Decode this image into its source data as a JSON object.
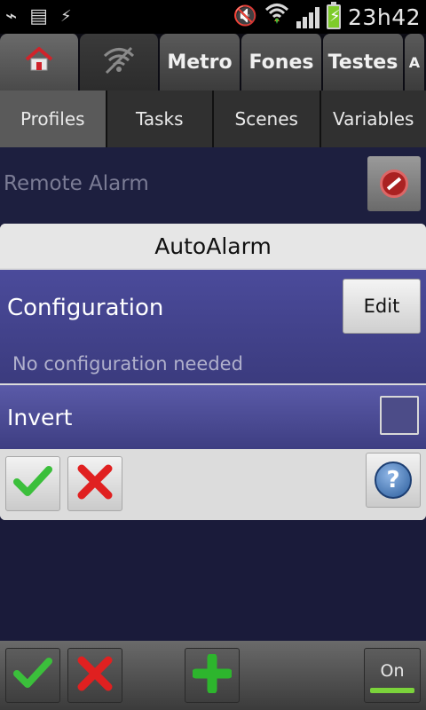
{
  "status_bar": {
    "time": "23h42",
    "icons": [
      "usb-icon",
      "sim-card-icon",
      "bolt-icon",
      "mute-icon",
      "wifi-icon",
      "signal-icon",
      "battery-icon"
    ]
  },
  "top_tabs": [
    {
      "label": "",
      "icon": "home-icon"
    },
    {
      "label": "",
      "icon": "wifi-icon"
    },
    {
      "label": "Metro"
    },
    {
      "label": "Fones"
    },
    {
      "label": "Testes"
    },
    {
      "label": "A"
    }
  ],
  "sub_tabs": [
    {
      "label": "Profiles",
      "active": true
    },
    {
      "label": "Tasks"
    },
    {
      "label": "Scenes"
    },
    {
      "label": "Variables"
    }
  ],
  "background_item": {
    "label": "Remote Alarm"
  },
  "dialog": {
    "title": "AutoAlarm",
    "configuration_label": "Configuration",
    "edit_label": "Edit",
    "configuration_note": "No configuration needed",
    "invert_label": "Invert",
    "invert_checked": false
  },
  "bottom_bar": {
    "on_label": "On"
  },
  "colors": {
    "accept": "#3bbf3b",
    "cancel": "#e02020",
    "add": "#2db52d",
    "panel": "#4b4b9b"
  }
}
